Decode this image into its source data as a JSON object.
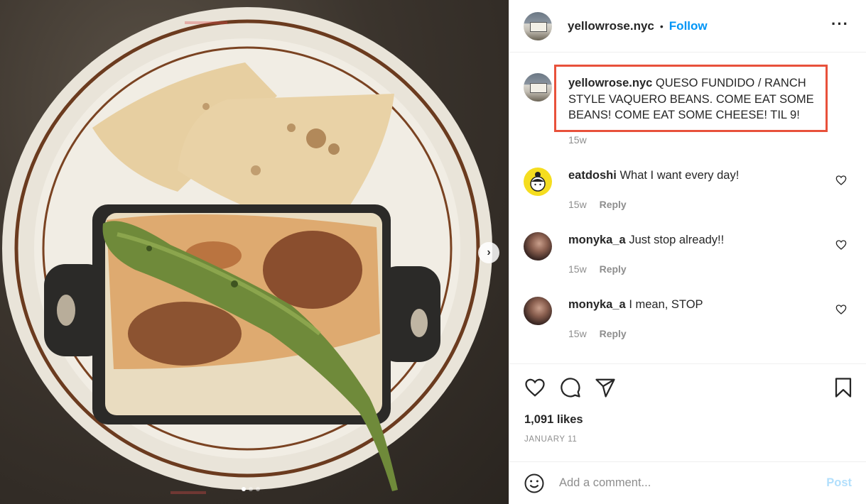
{
  "post": {
    "username": "yellowrose.nyc",
    "separator": "•",
    "follow_label": "Follow",
    "more_label": "···",
    "caption": "QUESO FUNDIDO / RANCH STYLE VAQUERO BEANS. COME EAT SOME BEANS! COME EAT SOME CHEESE! TIL 9!",
    "caption_time": "15w",
    "next_arrow": "›"
  },
  "comments": [
    {
      "username": "eatdoshi",
      "text": "What I want every day!",
      "time": "15w",
      "reply_label": "Reply",
      "avatar": "doshi-avatar"
    },
    {
      "username": "monyka_a",
      "text": "Just stop already!!",
      "time": "15w",
      "reply_label": "Reply",
      "avatar": "monyka-avatar"
    },
    {
      "username": "monyka_a",
      "text": "I mean, STOP",
      "time": "15w",
      "reply_label": "Reply",
      "avatar": "monyka-avatar"
    }
  ],
  "actions": {
    "likes": "1,091 likes",
    "date": "JANUARY 11",
    "icons": [
      "heart-icon",
      "comment-icon",
      "share-icon",
      "bookmark-icon"
    ]
  },
  "add_comment": {
    "placeholder": "Add a comment...",
    "post_label": "Post"
  },
  "colors": {
    "follow": "#0095f6",
    "highlight_box": "#e8513b",
    "post_disabled": "#b2dffc",
    "muted": "#8e8e8e"
  }
}
